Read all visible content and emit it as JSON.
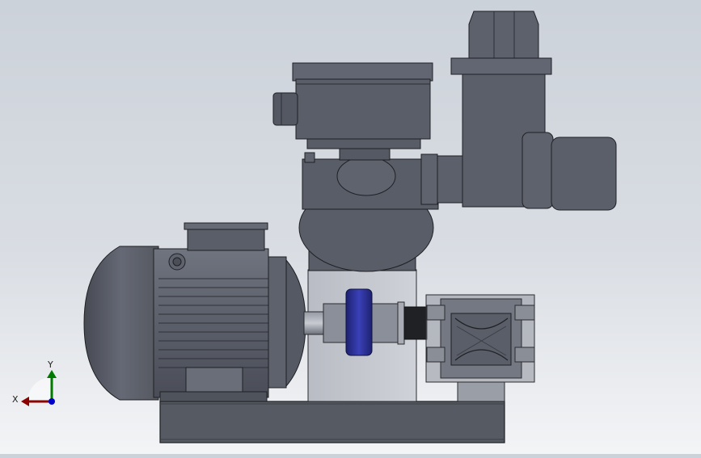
{
  "viewport": {
    "background_top": "#ccd2da",
    "background_bottom": "#f3f4f6",
    "model_color": "#5a5e6b",
    "coupling_color": "#2a2f9a"
  },
  "triad": {
    "x_label": "X",
    "y_label": "Y",
    "x_color": "#8b0000",
    "y_color": "#007a00",
    "z_color": "#0000cc"
  },
  "assembly": {
    "parts": [
      "electric-motor",
      "gearbox-housing",
      "control-box",
      "elbow-pipe",
      "shaft-coupling",
      "pump-head",
      "base-plate",
      "motor-mount-bracket"
    ]
  }
}
